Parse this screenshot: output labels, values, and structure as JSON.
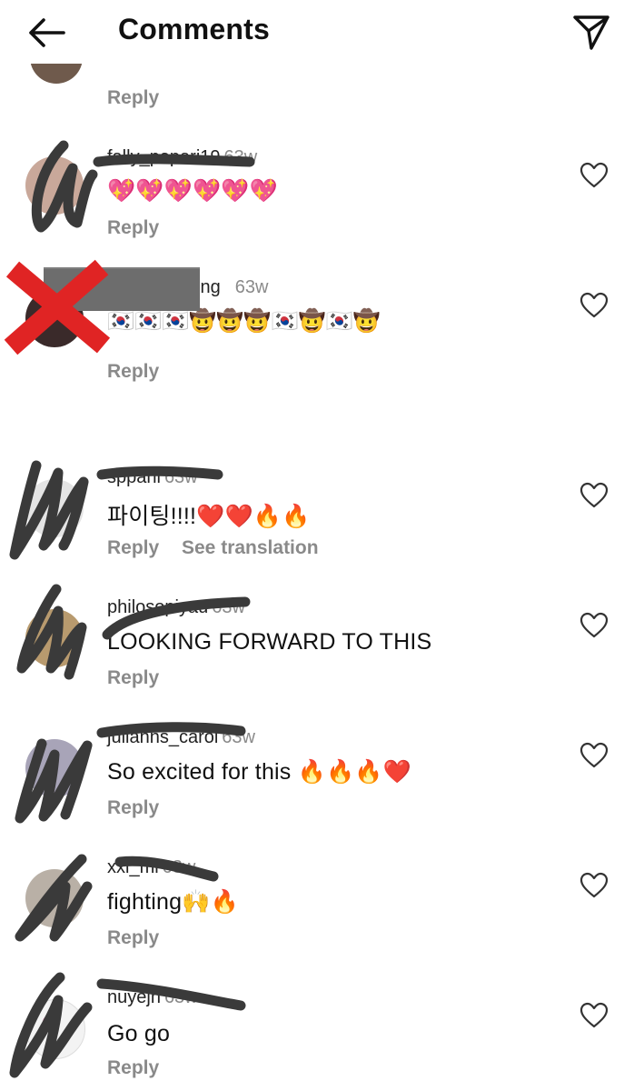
{
  "header": {
    "title": "Comments",
    "back_icon": "arrow-left-icon",
    "send_icon": "paper-plane-icon"
  },
  "labels": {
    "reply": "Reply",
    "see_translation": "See translation"
  },
  "comments": [
    {
      "username": "fally_papari19",
      "time": "63w",
      "text": "💖💖💖💖💖💖"
    },
    {
      "username": "ing",
      "time": "63w",
      "text": "🇰🇷🇰🇷🇰🇷🤠🤠🤠🇰🇷🤠🇰🇷🤠"
    },
    {
      "username": "sppani",
      "time": "63w",
      "text": "파이팅!!!!❤️❤️🔥🔥"
    },
    {
      "username": "philosopiyau",
      "time": "63w",
      "text": "LOOKING FORWARD TO THIS"
    },
    {
      "username": "julianns_carol",
      "time": "63w",
      "text": "So excited for this 🔥🔥🔥❤️"
    },
    {
      "username": "xxi_mi",
      "time": "63w",
      "text": "fighting🙌🔥"
    },
    {
      "username": "nuyejh",
      "time": "63w",
      "text": "Go go"
    }
  ],
  "colors": {
    "secondary_text": "#8a8a8a",
    "scribble": "#3a3a3a",
    "red_x": "#e02424",
    "redact_box": "#6d6d6d"
  }
}
